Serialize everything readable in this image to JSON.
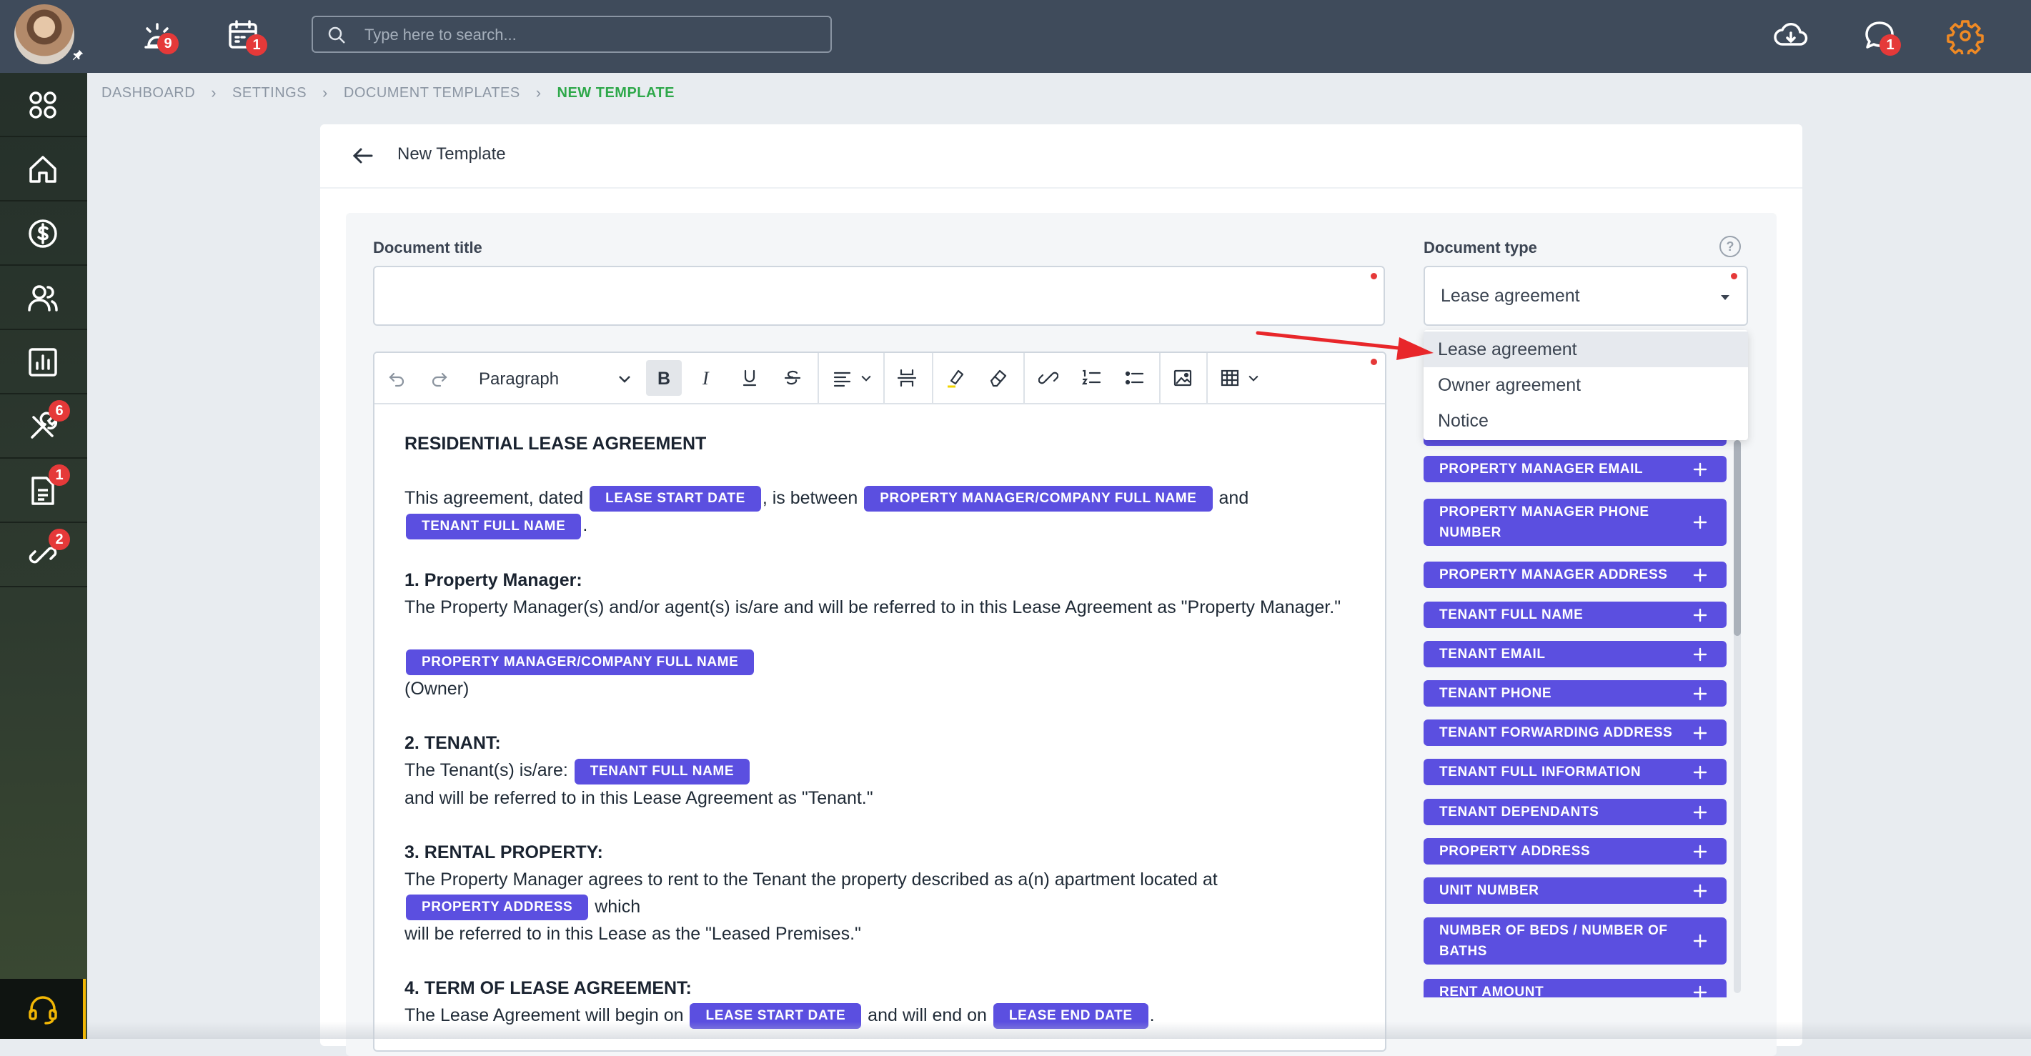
{
  "topbar": {
    "badges": {
      "alarm": "9",
      "calendar": "1",
      "chat": "1"
    },
    "search_placeholder": "Type here to search..."
  },
  "sidebar": {
    "items": [
      {
        "name": "dashboard-apps-icon",
        "badge": ""
      },
      {
        "name": "home-icon",
        "badge": ""
      },
      {
        "name": "dollar-icon",
        "badge": ""
      },
      {
        "name": "users-icon",
        "badge": ""
      },
      {
        "name": "reports-chart-icon",
        "badge": ""
      },
      {
        "name": "tools-icon",
        "badge": "6"
      },
      {
        "name": "document-icon",
        "badge": "1"
      },
      {
        "name": "link-icon",
        "badge": "2"
      }
    ]
  },
  "breadcrumb": [
    "DASHBOARD",
    "SETTINGS",
    "DOCUMENT TEMPLATES",
    "NEW TEMPLATE"
  ],
  "page": {
    "title": "New Template"
  },
  "form": {
    "document_title_label": "Document title",
    "document_title_value": "",
    "document_type_label": "Document type",
    "document_type_help": "?",
    "document_type_value": "Lease agreement",
    "document_type_options": [
      "Lease agreement",
      "Owner agreement",
      "Notice"
    ]
  },
  "editor": {
    "block_format": "Paragraph",
    "content": {
      "heading": "RESIDENTIAL LEASE AGREEMENT",
      "p1_a": "This agreement, dated",
      "p1_chip1": "LEASE START DATE",
      "p1_b": ", is between",
      "p1_chip2": "PROPERTY MANAGER/COMPANY FULL NAME",
      "p1_c": "and",
      "p1_chip3": "TENANT FULL NAME",
      "p1_d": ".",
      "s1_title": "1. Property Manager:",
      "s1_text": "The Property Manager(s) and/or agent(s) is/are and will be referred to in this Lease Agreement as \"Property Manager.\"",
      "s1_chip": "PROPERTY MANAGER/COMPANY FULL NAME",
      "s1_owner": "(Owner)",
      "s2_title": "2. TENANT:",
      "s2_a": "The Tenant(s) is/are:",
      "s2_chip": "TENANT FULL NAME",
      "s2_b": "and will be referred to in this Lease Agreement as \"Tenant.\"",
      "s3_title": "3. RENTAL PROPERTY:",
      "s3_a": "The Property Manager agrees to rent to the Tenant the property described as a(n) apartment located at",
      "s3_chip": "PROPERTY ADDRESS",
      "s3_b": "which",
      "s3_c": "will be referred to in this Lease as the \"Leased Premises.\"",
      "s4_title": "4. TERM OF LEASE AGREEMENT:",
      "s4_a": "The Lease Agreement will begin on",
      "s4_chip1": "LEASE START DATE",
      "s4_b": "and will end on",
      "s4_chip2": "LEASE END DATE",
      "s4_c": "."
    }
  },
  "fields": [
    "PROPERTY MANAGER EMAIL",
    "PROPERTY MANAGER PHONE NUMBER",
    "PROPERTY MANAGER ADDRESS",
    "TENANT FULL NAME",
    "TENANT EMAIL",
    "TENANT PHONE",
    "TENANT FORWARDING ADDRESS",
    "TENANT FULL INFORMATION",
    "TENANT DEPENDANTS",
    "PROPERTY ADDRESS",
    "UNIT NUMBER",
    "NUMBER OF BEDS / NUMBER OF BATHS",
    "RENT AMOUNT"
  ],
  "colors": {
    "topbar": "#3f4b5b",
    "chip": "#5b4fe0",
    "badge": "#e53939",
    "breadcrumb_active": "#2ea84a",
    "settings_gear": "#f08a24",
    "annotation_arrow": "#e8262a"
  }
}
